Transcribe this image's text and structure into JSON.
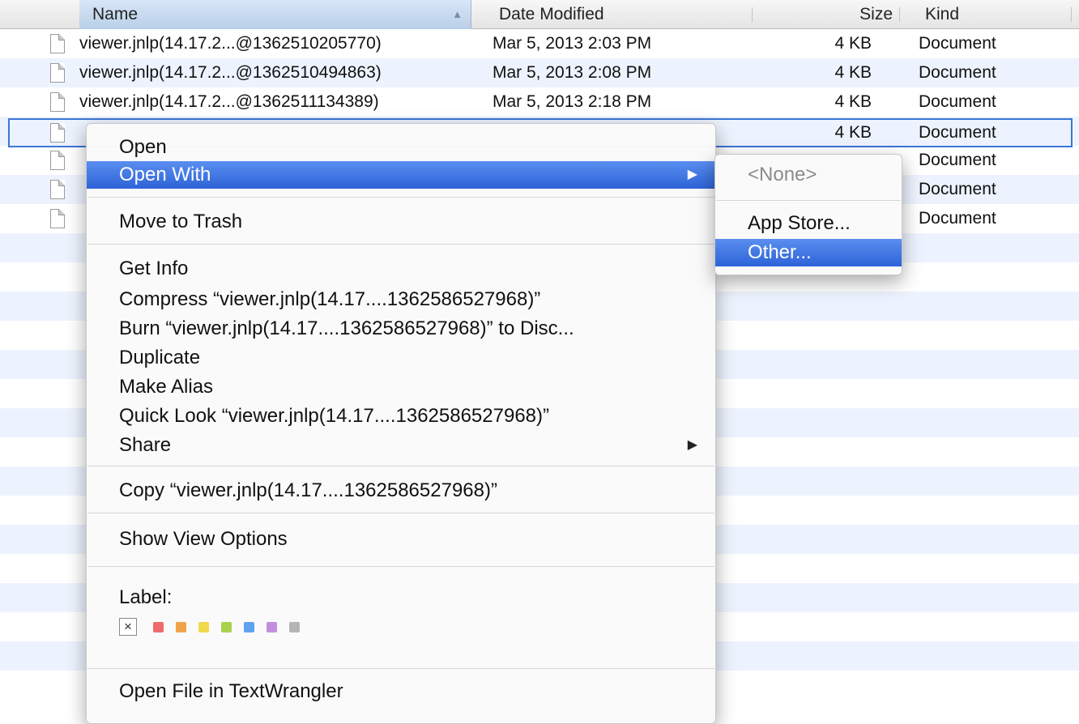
{
  "columns": {
    "name": "Name",
    "date": "Date Modified",
    "size": "Size",
    "kind": "Kind",
    "sort_indicator": "▲"
  },
  "files": [
    {
      "name": "viewer.jnlp(14.17.2...@1362510205770)",
      "date": "Mar 5, 2013 2:03 PM",
      "size": "4 KB",
      "kind": "Document"
    },
    {
      "name": "viewer.jnlp(14.17.2...@1362510494863)",
      "date": "Mar 5, 2013 2:08 PM",
      "size": "4 KB",
      "kind": "Document"
    },
    {
      "name": "viewer.jnlp(14.17.2...@1362511134389)",
      "date": "Mar 5, 2013 2:18 PM",
      "size": "4 KB",
      "kind": "Document"
    },
    {
      "name": "",
      "date": "",
      "size": "4 KB",
      "kind": "Document"
    },
    {
      "name": "",
      "date": "",
      "size": "",
      "kind": "Document"
    },
    {
      "name": "",
      "date": "",
      "size": "",
      "kind": "Document"
    },
    {
      "name": "",
      "date": "",
      "size": "",
      "kind": "Document"
    }
  ],
  "context_menu": {
    "items": [
      {
        "label": "Open"
      },
      {
        "label": "Open With",
        "submenu": true,
        "active": true
      },
      {
        "label": "Move to Trash"
      },
      {
        "label": "Get Info"
      },
      {
        "label": "Compress “viewer.jnlp(14.17....1362586527968)”"
      },
      {
        "label": "Burn “viewer.jnlp(14.17....1362586527968)” to Disc..."
      },
      {
        "label": "Duplicate"
      },
      {
        "label": "Make Alias"
      },
      {
        "label": "Quick Look “viewer.jnlp(14.17....1362586527968)”"
      },
      {
        "label": "Share",
        "submenu": true
      },
      {
        "label": "Copy “viewer.jnlp(14.17....1362586527968)”"
      },
      {
        "label": "Show View Options"
      },
      {
        "label": "Open File in TextWrangler"
      }
    ],
    "label_title": "Label:",
    "label_clear": "×",
    "label_colors": [
      "#ef6a6a",
      "#f2a24a",
      "#f1d94c",
      "#a7d24b",
      "#5fa3f0",
      "#c48ee0",
      "#b5b5b5"
    ],
    "submenu_arrow": "▶"
  },
  "submenu": {
    "items": [
      {
        "label": "<None>",
        "disabled": true
      },
      {
        "label": "App Store..."
      },
      {
        "label": "Other...",
        "active": true
      }
    ]
  }
}
